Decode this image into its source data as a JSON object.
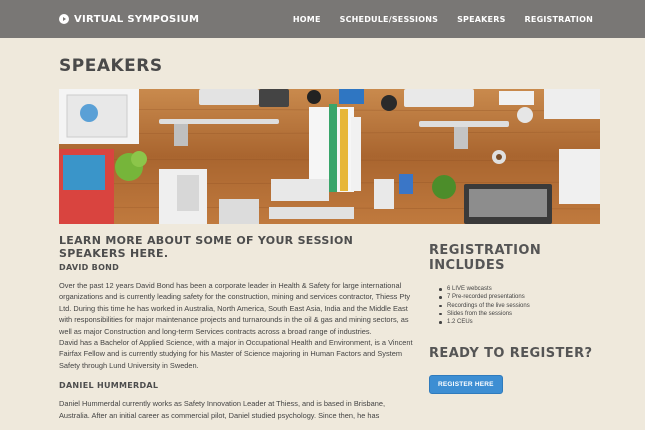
{
  "header": {
    "brand": "VIRTUAL SYMPOSIUM",
    "nav": [
      "HOME",
      "SCHEDULE/SESSIONS",
      "SPEAKERS",
      "REGISTRATION"
    ]
  },
  "page": {
    "title": "SPEAKERS"
  },
  "main": {
    "heading": "LEARN MORE ABOUT SOME OF YOUR SESSION SPEAKERS HERE.",
    "speakers": [
      {
        "name": "DAVID BOND",
        "paragraphs": [
          "Over the past 12 years David Bond has been a corporate leader in Health & Safety for large international organizations and is currently leading safety for the construction, mining and services contractor, Thiess Pty Ltd. During this time he has worked in Australia, North America, South East Asia, India and the Middle East with responsibilities for major maintenance projects and turnarounds in the oil & gas and mining sectors, as well as major Construction and long-term Services contracts across a broad range of industries.",
          "David has a Bachelor of Applied Science, with a major in Occupational Health and Environment, is a Vincent Fairfax Fellow and is currently studying for his Master of Science majoring in Human Factors and System Safety through Lund University in Sweden."
        ]
      },
      {
        "name": "DANIEL HUMMERDAL",
        "paragraphs": [
          "Daniel Hummerdal currently works as Safety Innovation Leader at Thiess, and is based in Brisbane, Australia. After an initial career as commercial pilot, Daniel studied psychology. Since then, he has"
        ]
      }
    ]
  },
  "sidebar": {
    "registration_heading": "REGISTRATION INCLUDES",
    "items": [
      "6 LIVE webcasts",
      "7 Pre-recorded presentations",
      "Recordings of the live sessions",
      "Slides from the sessions",
      "1.2 CEUs"
    ],
    "ready_heading": "READY TO REGISTER?",
    "register_button": "REGISTER HERE"
  },
  "colors": {
    "topbar": "#797775",
    "background": "#efe9dc",
    "button": "#3d8ed3",
    "desk": "#b9773f"
  }
}
